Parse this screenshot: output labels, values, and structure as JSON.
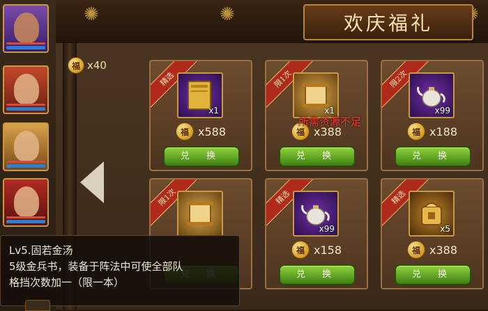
{
  "title": "欢庆福礼",
  "currency": {
    "icon": "fu-coin-icon",
    "coin_char": "福",
    "amount": "x40"
  },
  "exchange_label": "兑 换",
  "warning": "所需资源不足",
  "cards": [
    {
      "ribbon": "精选",
      "item": "golden-book-icon",
      "qty": "x1",
      "price": "x588"
    },
    {
      "ribbon": "限1次",
      "item": "scroll-icon",
      "qty": "x1",
      "price": "x388"
    },
    {
      "ribbon": "限2次",
      "item": "silver-teapot-icon",
      "qty": "x99",
      "price": "x188"
    },
    {
      "ribbon": "限1次",
      "item": "scroll-icon",
      "qty": "",
      "price": ""
    },
    {
      "ribbon": "精选",
      "item": "silver-teapot-icon",
      "qty": "x99",
      "price": "x158"
    },
    {
      "ribbon": "精选",
      "item": "golden-seal-icon",
      "qty": "x5",
      "price": "x388"
    }
  ],
  "tooltip": {
    "line1": "Lv5.固若金汤",
    "line2": "5级金兵书，装备于阵法中可使全部队",
    "line3": "格挡次数加一（限一本）"
  },
  "colors": {
    "ribbon": "#b02a1c",
    "button": "#6bb42a",
    "warning": "#ff3b2f",
    "coin": "#d39a23"
  }
}
